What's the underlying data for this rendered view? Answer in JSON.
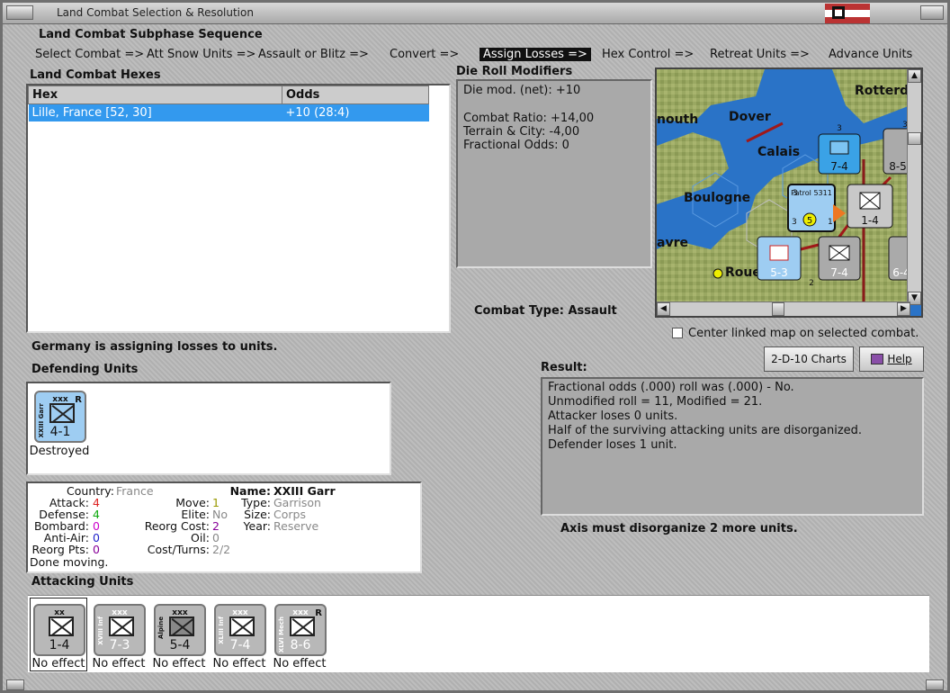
{
  "window": {
    "title": "Land Combat Selection & Resolution"
  },
  "subphase": {
    "heading": "Land Combat Subphase Sequence",
    "steps": [
      "Select Combat =>",
      "Att Snow Units =>",
      "Assault or Blitz =>",
      "Convert =>",
      "Assign Losses =>",
      "Hex Control =>",
      "Retreat Units =>",
      "Advance Units"
    ],
    "active": "Assign Losses =>"
  },
  "hexes": {
    "heading": "Land Combat Hexes",
    "col_hex": "Hex",
    "col_odds": "Odds",
    "rows": [
      {
        "hex": "Lille, France [52, 30]",
        "odds": "+10 (28:4)"
      }
    ]
  },
  "modifiers": {
    "heading": "Die Roll Modifiers",
    "net": "Die mod. (net): +10",
    "lines": [
      "Combat Ratio: +14,00",
      "Terrain & City: -4,00",
      "Fractional Odds: 0"
    ]
  },
  "map": {
    "labels": [
      "Rotterd",
      "Dover",
      "nouth",
      "Calais",
      "Boulogne",
      "avre",
      "Roue"
    ],
    "units": [
      {
        "str": "7-4",
        "badge": "3"
      },
      {
        "str": "8-5",
        "badge": "3"
      },
      {
        "str": "1-4",
        "badge": ""
      },
      {
        "str": "5-3",
        "badge": ""
      },
      {
        "str": "7-4",
        "badge": "2"
      },
      {
        "str": "6-4",
        "badge": ""
      }
    ],
    "stack_label": "Patrol 5311",
    "stack_nums": [
      "3",
      "5",
      "3",
      "1"
    ]
  },
  "combat_type": {
    "label": "Combat Type:",
    "value": "Assault"
  },
  "center_map": {
    "label": "Center linked map on selected combat.",
    "checked": false
  },
  "assigning_msg": "Germany is assigning losses to units.",
  "defending": {
    "heading": "Defending Units",
    "units": [
      {
        "size": "xxx",
        "side": "XXIII Garr",
        "str": "4-1",
        "reserve": "R",
        "status": "Destroyed",
        "color": "#9ecdf2"
      }
    ]
  },
  "buttons": {
    "charts": "2-D-10 Charts",
    "help": "Help"
  },
  "result": {
    "heading": "Result:",
    "lines": [
      "Fractional odds (.000) roll was (.000)  - No.",
      "Unmodified roll = 11, Modified = 21.",
      "Attacker loses 0 units.",
      "Half of the surviving attacking units are disorganized.",
      "Defender loses 1 unit."
    ]
  },
  "unit_info": {
    "country_label": "Country:",
    "country": "France",
    "attack_label": "Attack:",
    "attack": "4",
    "defense_label": "Defense:",
    "defense": "4",
    "bombard_label": "Bombard:",
    "bombard": "0",
    "antiair_label": "Anti-Air:",
    "antiair": "0",
    "reorgpts_label": "Reorg Pts:",
    "reorgpts": "0",
    "move_label": "Move:",
    "move": "1",
    "elite_label": "Elite:",
    "elite": "No",
    "reorgcost_label": "Reorg Cost:",
    "reorgcost": "2",
    "oil_label": "Oil:",
    "oil": "0",
    "costturns_label": "Cost/Turns:",
    "costturns": "2/2",
    "name_label": "Name:",
    "name": "XXIII Garr",
    "type_label": "Type:",
    "type": "Garrison",
    "size_label": "Size:",
    "size": "Corps",
    "year_label": "Year:",
    "year": "Reserve",
    "done": "Done moving."
  },
  "disorganize_msg": "Axis must disorganize 2 more units.",
  "attacking": {
    "heading": "Attacking Units",
    "units": [
      {
        "size": "xx",
        "side": "",
        "str": "1-4",
        "status": "No effect",
        "reserve": ""
      },
      {
        "size": "xxx",
        "side": "XVIII Inf",
        "str": "7-3",
        "status": "No effect",
        "reserve": ""
      },
      {
        "size": "xxx",
        "side": "Alpine",
        "str": "5-4",
        "status": "No effect",
        "reserve": ""
      },
      {
        "size": "xxx",
        "side": "XLIII Inf",
        "str": "7-4",
        "status": "No effect",
        "reserve": ""
      },
      {
        "size": "xxx",
        "side": "XLVI Mech",
        "str": "8-6",
        "status": "No effect",
        "reserve": "R"
      }
    ]
  },
  "colors": {
    "selection": "#3399ee",
    "sea": "#2a73c7",
    "unit_gray": "#b8b8b8",
    "unit_blue": "#9ecdf2"
  }
}
